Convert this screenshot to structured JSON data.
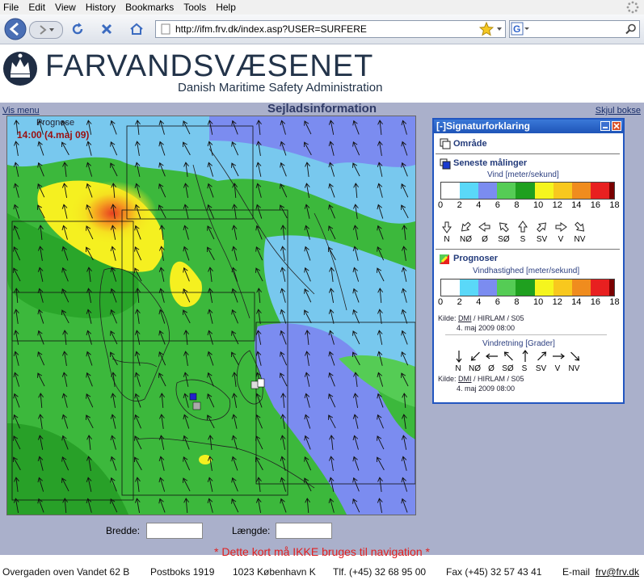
{
  "browser": {
    "menu": [
      "File",
      "Edit",
      "View",
      "History",
      "Bookmarks",
      "Tools",
      "Help"
    ],
    "url": "http://ifm.frv.dk/index.asp?USER=SURFERE"
  },
  "header": {
    "logo_text": "FARVANDSVÆSENET",
    "logo_sub": "Danish Maritime Safety Administration"
  },
  "page": {
    "vis_menu": "Vis menu",
    "title": "Sejladsinformation",
    "skjul": "Skjul bokse"
  },
  "map": {
    "prognose_label": "Prognose",
    "time_label": "14:00 (4.maj 09)"
  },
  "coords": {
    "bredde_label": "Bredde:",
    "laengde_label": "Længde:",
    "bredde_value": "",
    "laengde_value": ""
  },
  "warning": "* Dette kort må IKKE bruges til navigation *",
  "footer": {
    "address": "Overgaden oven Vandet 62 B",
    "box": "Postboks 1919",
    "city": "1023 København K",
    "phone": "Tlf. (+45) 32 68 95 00",
    "fax": "Fax (+45) 32 57 43 41",
    "email_label": "E-mail",
    "email": "frv@frv.dk"
  },
  "legend": {
    "title": "[-]Signaturforklaring",
    "omrade": "Område",
    "seneste": "Seneste målinger",
    "vind_label": "Vind [meter/sekund]",
    "scale_numbers": [
      "0",
      "2",
      "4",
      "6",
      "8",
      "10",
      "12",
      "14",
      "16",
      "18"
    ],
    "dirs": [
      "N",
      "NØ",
      "Ø",
      "SØ",
      "S",
      "SV",
      "V",
      "NV"
    ],
    "prognoser": "Prognoser",
    "vindhast_label": "Vindhastighed [meter/sekund]",
    "kilde_label": "Kilde:",
    "kilde_link": "DMI",
    "kilde_rest": " / HIRLAM / S05",
    "kilde_date": "4. maj 2009 08:00",
    "vindretning_label": "Vindretning [Grader]",
    "colors": [
      "#ffffff",
      "#5ad8f8",
      "#7b8cf0",
      "#55cc55",
      "#1fa01f",
      "#f5f51e",
      "#f8c81e",
      "#f08c1e",
      "#e82020",
      "#7a0000"
    ]
  }
}
